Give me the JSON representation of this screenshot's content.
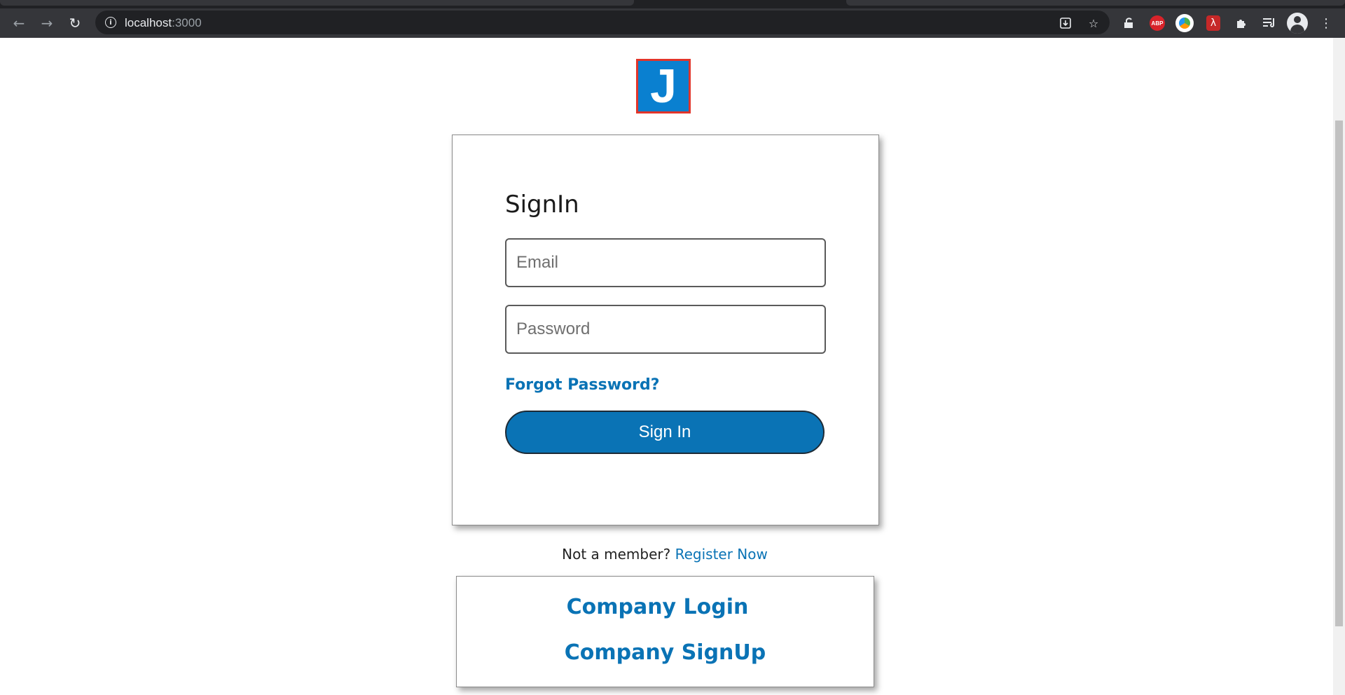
{
  "browser": {
    "url_host": "localhost",
    "url_port": ":3000",
    "icons": {
      "back": "arrow-left-icon",
      "forward": "arrow-right-icon",
      "reload": "reload-icon",
      "site_info": "info-icon",
      "install": "install-icon",
      "bookmark": "star-icon",
      "extensions": "puzzle-icon",
      "reading_list": "reading-list-icon",
      "profile": "profile-icon",
      "menu": "kebab-menu-icon"
    },
    "extensions": {
      "abp_label": "ABP"
    }
  },
  "page": {
    "logo_letter": "J",
    "signin": {
      "heading": "SignIn",
      "email_placeholder": "Email",
      "password_placeholder": "Password",
      "forgot_label": "Forgot Password?",
      "button_label": "Sign In"
    },
    "register": {
      "prompt": "Not a member?",
      "link_label": "Register Now"
    },
    "company": {
      "login_label": "Company Login",
      "signup_label": "Company SignUp"
    }
  },
  "colors": {
    "brand_blue": "#0a73b5",
    "logo_blue": "#0a80d0",
    "logo_border": "#e2352a",
    "chrome_dark": "#35363a"
  }
}
